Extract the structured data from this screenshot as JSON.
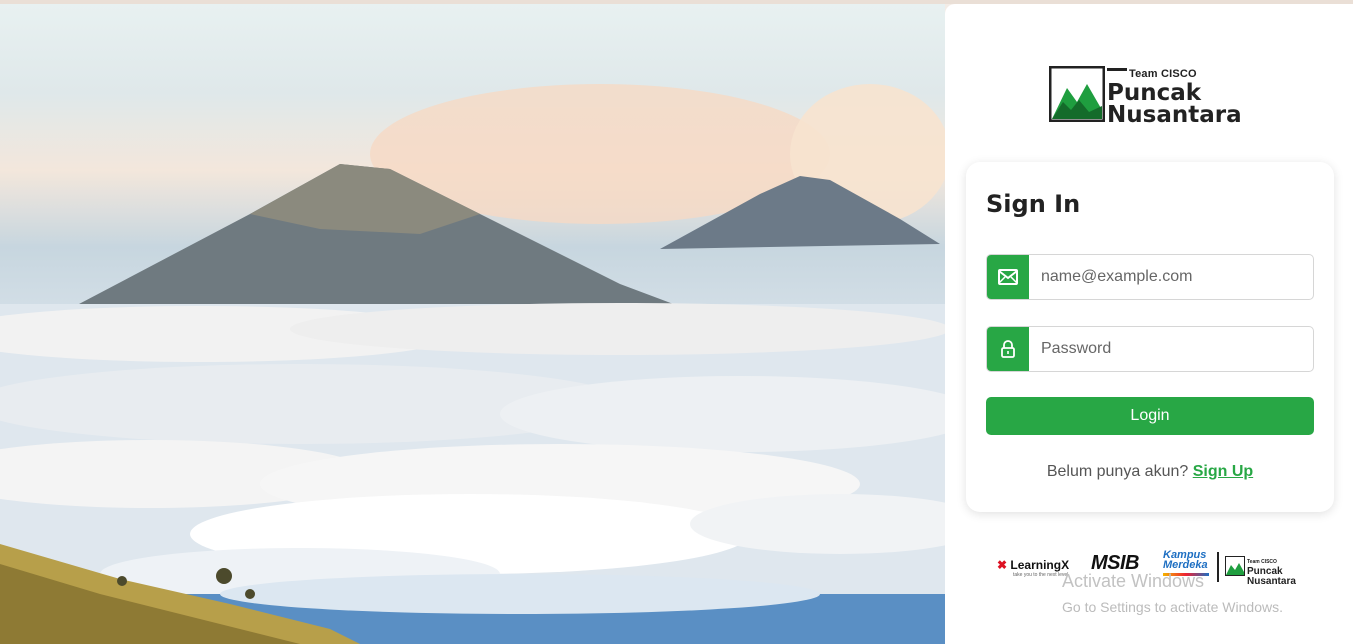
{
  "brand": {
    "tagline": "Team CISCO",
    "title_line1": "Puncak",
    "title_line2": "Nusantara"
  },
  "signin": {
    "heading": "Sign In",
    "email_placeholder": "name@example.com",
    "password_placeholder": "Password",
    "login_label": "Login",
    "signup_prompt": "Belum punya akun?",
    "signup_link": "Sign Up"
  },
  "partners": {
    "learningx": "LearningX",
    "learningx_sub": "take you to the next level",
    "msib": "MSIB",
    "kampus_line1": "Kampus",
    "kampus_line2": "Merdeka",
    "puncak_tag": "Team CISCO",
    "puncak_line1": "Puncak",
    "puncak_line2": "Nusantara"
  },
  "watermark": {
    "line1": "Activate Windows",
    "line2": "Go to Settings to activate Windows."
  },
  "colors": {
    "accent": "#28a745",
    "text_dark": "#222222"
  },
  "icons": {
    "email": "envelope-icon",
    "password": "lock-icon"
  }
}
